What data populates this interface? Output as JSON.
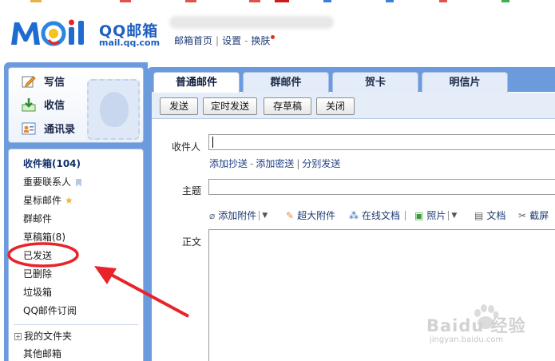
{
  "header": {
    "brand": "QQ邮箱",
    "brand_url": "mail.qq.com",
    "links": [
      "邮箱首页",
      "设置",
      "换肤"
    ]
  },
  "quick_actions": [
    {
      "label": "写信",
      "icon": "write-icon"
    },
    {
      "label": "收信",
      "icon": "inbox-download-icon"
    },
    {
      "label": "通讯录",
      "icon": "contacts-icon"
    }
  ],
  "folders": {
    "inbox": "收件箱(104)",
    "important": "重要联系人",
    "starred": "星标邮件",
    "group": "群邮件",
    "drafts": "草稿箱(8)",
    "sent": "已发送",
    "deleted": "已删除",
    "trash": "垃圾箱",
    "subscription": "QQ邮件订阅",
    "my_folders": "我的文件夹",
    "other_mailboxes": "其他邮箱"
  },
  "compose": {
    "tabs": [
      "普通邮件",
      "群邮件",
      "贺卡",
      "明信片"
    ],
    "active_tab": "普通邮件",
    "toolbar": [
      "发送",
      "定时发送",
      "存草稿",
      "关闭"
    ],
    "labels": {
      "to": "收件人",
      "subject": "主题",
      "body": "正文"
    },
    "recipient_links": [
      "添加抄送",
      "添加密送",
      "分别发送"
    ],
    "attach_tools": [
      "添加附件",
      "超大附件",
      "在线文档",
      "照片",
      "文档",
      "截屏"
    ]
  },
  "watermark": {
    "logo": "Baidu 经验",
    "url": "jingyan.baidu.com"
  },
  "colors": {
    "frame_blue": "#6b9bdc",
    "brand_blue": "#1f5fbf",
    "annotation_red": "#e8242a"
  }
}
